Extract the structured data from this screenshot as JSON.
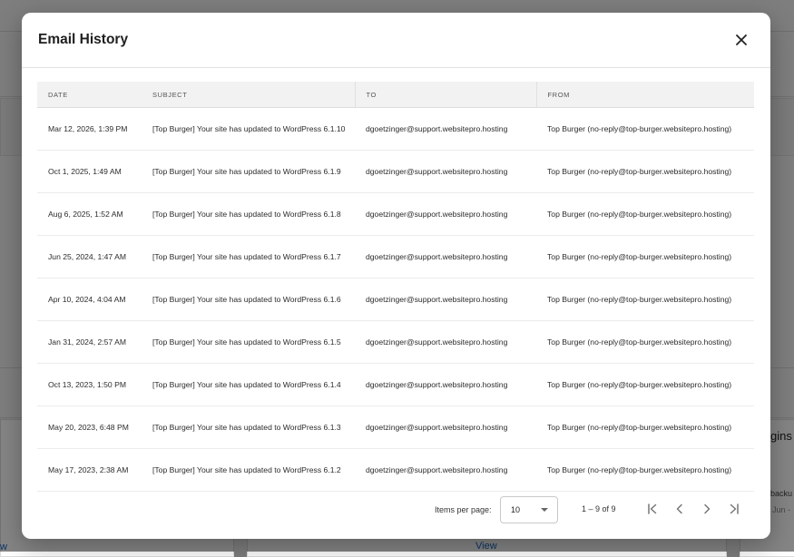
{
  "modal": {
    "title": "Email History",
    "close_icon": "close-icon"
  },
  "table": {
    "columns": [
      "DATE",
      "SUBJECT",
      "TO",
      "FROM"
    ],
    "rows": [
      {
        "date": "Mar 12, 2026, 1:39 PM",
        "subject": "[Top Burger] Your site has updated to WordPress 6.1.10",
        "to": "dgoetzinger@support.websitepro.hosting",
        "from": "Top Burger (no-reply@top-burger.websitepro.hosting)"
      },
      {
        "date": "Oct 1, 2025, 1:49 AM",
        "subject": "[Top Burger] Your site has updated to WordPress 6.1.9",
        "to": "dgoetzinger@support.websitepro.hosting",
        "from": "Top Burger (no-reply@top-burger.websitepro.hosting)"
      },
      {
        "date": "Aug 6, 2025, 1:52 AM",
        "subject": "[Top Burger] Your site has updated to WordPress 6.1.8",
        "to": "dgoetzinger@support.websitepro.hosting",
        "from": "Top Burger (no-reply@top-burger.websitepro.hosting)"
      },
      {
        "date": "Jun 25, 2024, 1:47 AM",
        "subject": "[Top Burger] Your site has updated to WordPress 6.1.7",
        "to": "dgoetzinger@support.websitepro.hosting",
        "from": "Top Burger (no-reply@top-burger.websitepro.hosting)"
      },
      {
        "date": "Apr 10, 2024, 4:04 AM",
        "subject": "[Top Burger] Your site has updated to WordPress 6.1.6",
        "to": "dgoetzinger@support.websitepro.hosting",
        "from": "Top Burger (no-reply@top-burger.websitepro.hosting)"
      },
      {
        "date": "Jan 31, 2024, 2:57 AM",
        "subject": "[Top Burger] Your site has updated to WordPress 6.1.5",
        "to": "dgoetzinger@support.websitepro.hosting",
        "from": "Top Burger (no-reply@top-burger.websitepro.hosting)"
      },
      {
        "date": "Oct 13, 2023, 1:50 PM",
        "subject": "[Top Burger] Your site has updated to WordPress 6.1.4",
        "to": "dgoetzinger@support.websitepro.hosting",
        "from": "Top Burger (no-reply@top-burger.websitepro.hosting)"
      },
      {
        "date": "May 20, 2023, 6:48 PM",
        "subject": "[Top Burger] Your site has updated to WordPress 6.1.3",
        "to": "dgoetzinger@support.websitepro.hosting",
        "from": "Top Burger (no-reply@top-burger.websitepro.hosting)"
      },
      {
        "date": "May 17, 2023, 2:38 AM",
        "subject": "[Top Burger] Your site has updated to WordPress 6.1.2",
        "to": "dgoetzinger@support.websitepro.hosting",
        "from": "Top Burger (no-reply@top-burger.websitepro.hosting)"
      }
    ]
  },
  "paginator": {
    "items_per_page_label": "Items per page:",
    "items_per_page_value": "10",
    "range_label": "1 – 9 of 9",
    "icons": [
      "first-page-icon",
      "previous-page-icon",
      "next-page-icon",
      "last-page-icon"
    ]
  },
  "background": {
    "link_view": "View",
    "link_partial": "w",
    "fragment_right": "gins",
    "fragment_small_1": "backu",
    "fragment_small_2": "Jun -"
  },
  "colors": {
    "link": "#1565c0",
    "overlay": "rgba(0,0,0,0.48)",
    "header_bg": "#f2f2f2"
  }
}
